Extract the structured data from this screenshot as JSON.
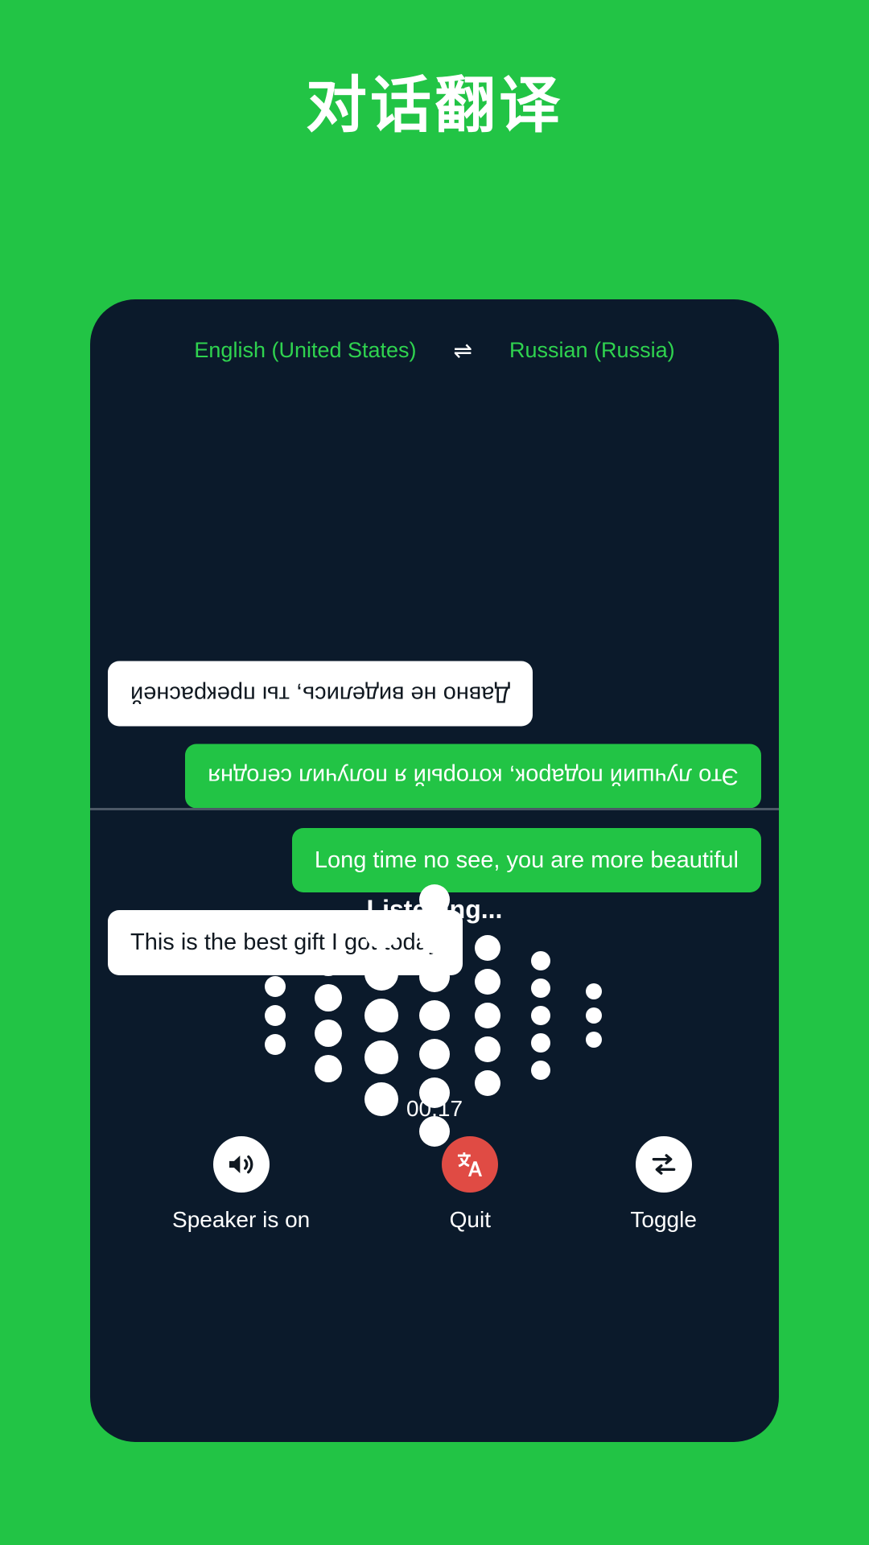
{
  "page": {
    "title": "对话翻译",
    "background_color": "#22c445",
    "panel_color": "#0b1a2b"
  },
  "language_bar": {
    "source": "English (United States)",
    "swap_icon": "swap-horizontal-icon",
    "swap_glyph": "⇌",
    "target": "Russian (Russia)",
    "text_color": "#2fd34f"
  },
  "conversation": {
    "top_panel_rotated": true,
    "top_messages": [
      {
        "text": "Это лучший подарок, который я получил сегодня",
        "style": "green",
        "align": "left"
      },
      {
        "text": "Давно не виделись, ты прекрасней",
        "style": "white",
        "align": "right"
      }
    ],
    "bottom_messages": [
      {
        "text": "Long time no see, you are more beautiful",
        "style": "green",
        "align": "right"
      },
      {
        "text": "This is the best gift I got today",
        "style": "white",
        "align": "left"
      }
    ]
  },
  "status": {
    "listening_label": "Listening...",
    "timer": "00:17"
  },
  "waveform": {
    "dot_color": "#ffffff",
    "columns": [
      {
        "count": 3,
        "size": 13
      },
      {
        "count": 4,
        "size": 17
      },
      {
        "count": 5,
        "size": 21
      },
      {
        "count": 7,
        "size": 19
      },
      {
        "count": 5,
        "size": 16
      },
      {
        "count": 5,
        "size": 12
      },
      {
        "count": 3,
        "size": 10
      }
    ]
  },
  "controls": [
    {
      "label": "Speaker is on",
      "icon": "speaker-on-icon",
      "circle_color": "#ffffff",
      "icon_color": "#101820"
    },
    {
      "label": "Quit",
      "icon": "translate-icon",
      "circle_color": "#e04b44",
      "icon_color": "#ffffff"
    },
    {
      "label": "Toggle",
      "icon": "swap-arrows-icon",
      "circle_color": "#ffffff",
      "icon_color": "#101820"
    }
  ]
}
